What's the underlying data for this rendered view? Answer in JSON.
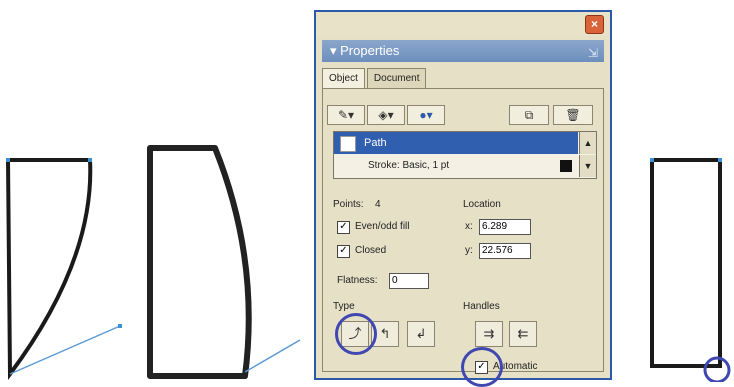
{
  "panel": {
    "close_symbol": "×",
    "title": "▾ Properties",
    "grip_symbol": "⇲",
    "tabs": [
      {
        "label": "Object",
        "active": true
      },
      {
        "label": "Document",
        "active": false
      }
    ],
    "toolbar_icons": [
      "pen-add-icon",
      "fill-add-icon",
      "effect-add-icon",
      "duplicate-icon",
      "trash-icon"
    ],
    "toolbar_glyphs": {
      "stroke": "✎▾",
      "fill": "◈▾",
      "effect": "●▾",
      "duplicate": "⧉",
      "trash": "🗑"
    },
    "attributes": {
      "selected_item": "Path",
      "stroke_item": "Stroke: Basic, 1 pt",
      "scroll_up": "▲",
      "scroll_down": "▼"
    },
    "points_label": "Points:",
    "points_value": "4",
    "evenodd_label": "Even/odd fill",
    "evenodd_checked": true,
    "closed_label": "Closed",
    "closed_checked": true,
    "flatness_label": "Flatness:",
    "flatness_value": "0",
    "location_label": "Location",
    "x_label": "x:",
    "x_value": "6.289",
    "y_label": "y:",
    "y_value": "22.576",
    "type_label": "Type",
    "type_glyphs": [
      "⤴",
      "↰",
      "↲"
    ],
    "handles_label": "Handles",
    "handle_glyphs": [
      "⇉",
      "⇇"
    ],
    "automatic_label": "Automatic",
    "automatic_checked": true,
    "check_mark": "✓"
  },
  "colors": {
    "panel_bg": "#e6e0c7",
    "selection_blue": "#2f5fae",
    "highlight_circle": "#3f47b0",
    "anchor_point": "#3d8fd6"
  }
}
